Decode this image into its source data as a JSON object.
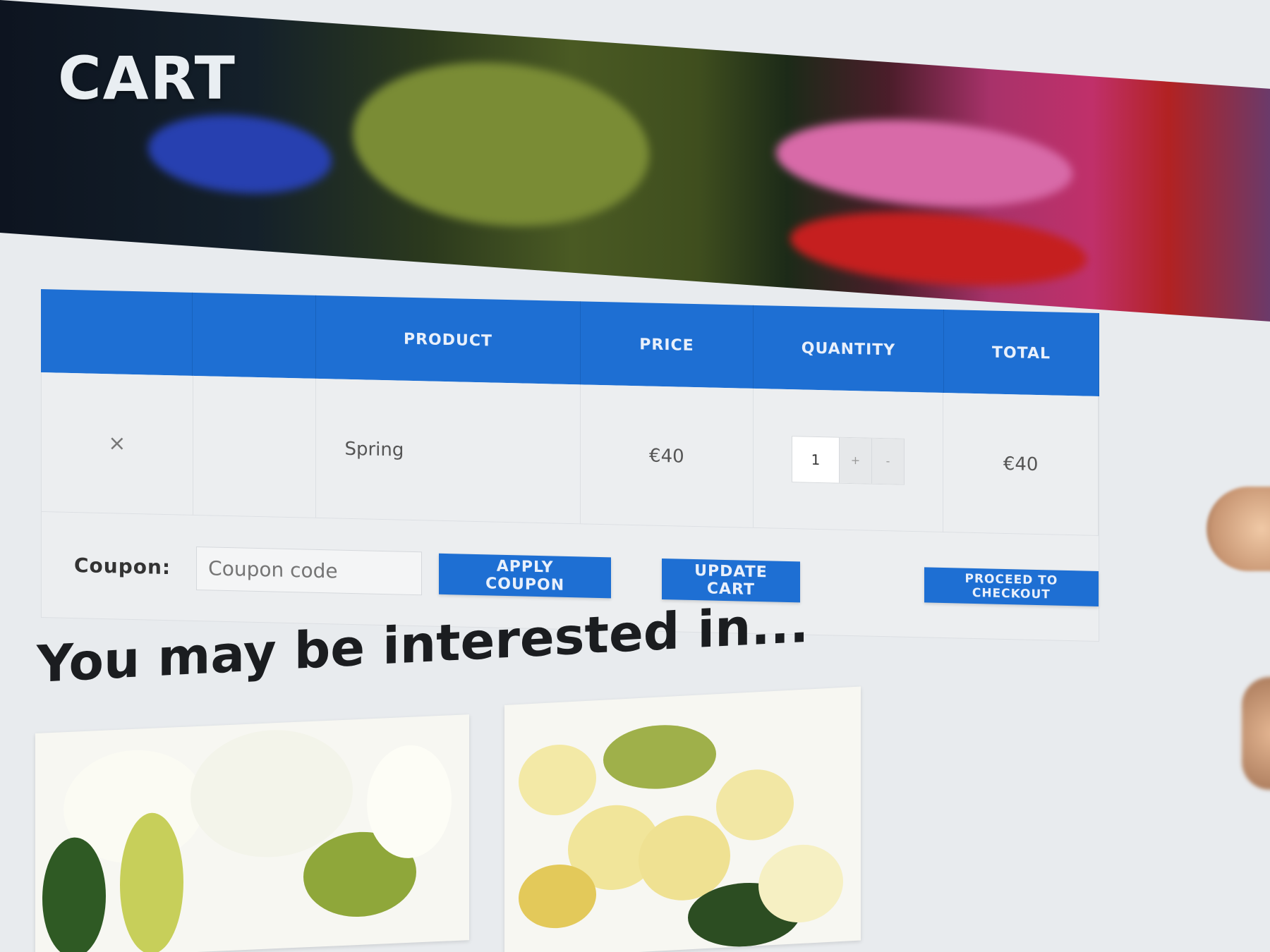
{
  "hero": {
    "title": "CART"
  },
  "cart": {
    "headers": [
      "",
      "",
      "PRODUCT",
      "PRICE",
      "QUANTITY",
      "TOTAL"
    ],
    "items": [
      {
        "remove": "×",
        "name": "Spring",
        "price": "€40",
        "quantity": "1",
        "increment": "+",
        "decrement": "-",
        "total": "€40"
      }
    ],
    "coupon": {
      "label": "Coupon:",
      "placeholder": "Coupon code"
    },
    "buttons": {
      "apply": "APPLY COUPON",
      "update": "UPDATE CART",
      "checkout": "PROCEED TO CHECKOUT"
    }
  },
  "suggestions": {
    "title": "You may be interested in..."
  },
  "colors": {
    "accent": "#1e6fd3",
    "page_bg": "#e8ebee"
  }
}
